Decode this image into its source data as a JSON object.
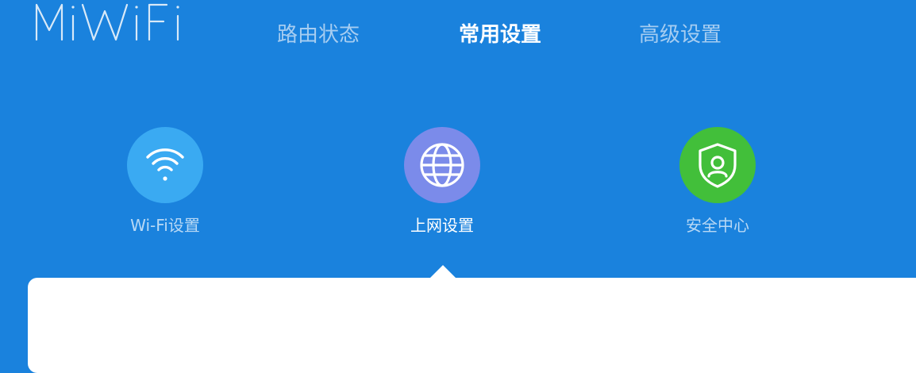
{
  "brand": {
    "logo_text": "MiWiFi"
  },
  "nav": {
    "items": [
      {
        "label": "路由状态",
        "active": false
      },
      {
        "label": "常用设置",
        "active": true
      },
      {
        "label": "高级设置",
        "active": false
      }
    ]
  },
  "features": {
    "items": [
      {
        "label": "Wi-Fi设置",
        "icon": "wifi-icon",
        "color": "#3aaaf2",
        "active": false
      },
      {
        "label": "上网设置",
        "icon": "globe-icon",
        "color": "#7b8bea",
        "active": true
      },
      {
        "label": "安全中心",
        "icon": "shield-icon",
        "color": "#42bf3a",
        "active": false
      }
    ]
  },
  "colors": {
    "background": "#1a82dd",
    "nav_inactive": "#a6cdf1",
    "nav_active": "#ffffff",
    "panel": "#ffffff"
  }
}
